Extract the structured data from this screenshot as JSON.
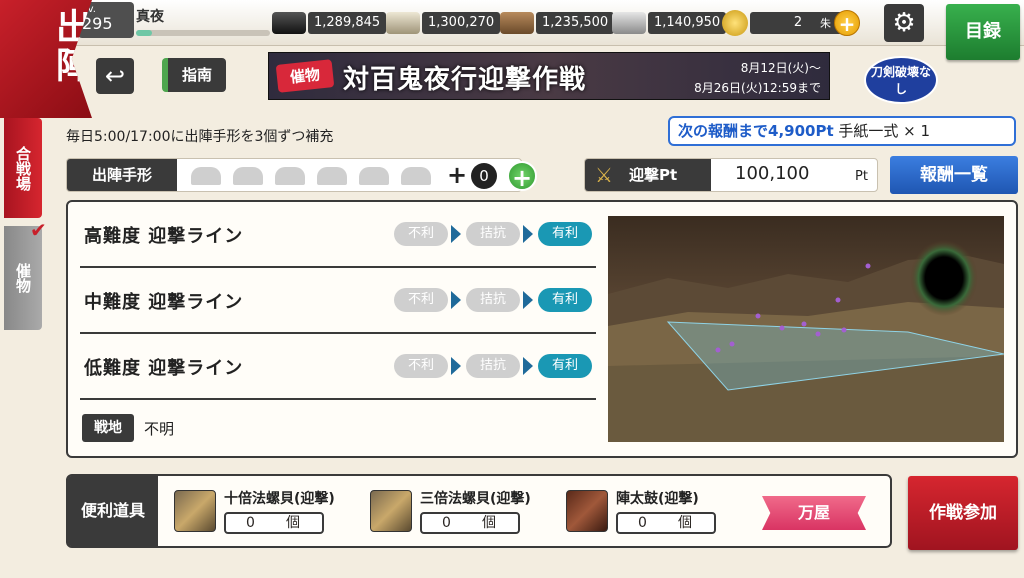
{
  "header": {
    "sortie_label": "出陣",
    "level_prefix": "Lv.",
    "level": "295",
    "player_name": "真夜",
    "xp_fraction": 0.12,
    "resources": [
      {
        "icon": "charcoal-icon",
        "value": "1,289,845"
      },
      {
        "icon": "jade-steel-icon",
        "value": "1,300,270"
      },
      {
        "icon": "cold-steel-icon",
        "value": "1,235,500"
      },
      {
        "icon": "whetstone-icon",
        "value": "1,140,950"
      }
    ],
    "coin_value": "2",
    "coin_unit": "朱",
    "catalog_label": "目録"
  },
  "nav": {
    "guide_label": "指南"
  },
  "banner": {
    "tag": "催物",
    "title": "対百鬼夜行迎撃作戦",
    "date_start": "8月12日(火)～",
    "date_end": "8月26日(火)12:59まで"
  },
  "sword_break": "刀剣破壊なし",
  "side_tabs": {
    "battle": "合戦場",
    "event": "催物"
  },
  "daily_note": "毎日5:00/17:00に出陣手形を3個ずつ補充",
  "next_reward": {
    "prefix": "次の報酬まで4,900Pt",
    "reward": "手紙一式 × 1"
  },
  "tegata": {
    "label": "出陣手形",
    "count": "0"
  },
  "points": {
    "label": "迎撃Pt",
    "value": "100,100",
    "unit": "Pt",
    "reward_list_label": "報酬一覧"
  },
  "lines": [
    {
      "name": "高難度 迎撃ライン",
      "states": [
        "不利",
        "拮抗",
        "有利"
      ]
    },
    {
      "name": "中難度 迎撃ライン",
      "states": [
        "不利",
        "拮抗",
        "有利"
      ]
    },
    {
      "name": "低難度 迎撃ライン",
      "states": [
        "不利",
        "拮抗",
        "有利"
      ]
    }
  ],
  "field": {
    "label": "戦地",
    "value": "不明"
  },
  "items": {
    "label": "便利道具",
    "list": [
      {
        "name": "十倍法螺貝(迎撃)",
        "count": "0",
        "unit": "個"
      },
      {
        "name": "三倍法螺貝(迎撃)",
        "count": "0",
        "unit": "個"
      },
      {
        "name": "陣太鼓(迎撃)",
        "count": "0",
        "unit": "個"
      }
    ],
    "shop_label": "万屋"
  },
  "join_label": "作戦参加",
  "colors": {
    "accent_red": "#c8202a",
    "favorable": "#1a98b4",
    "reward_blue": "#1f56b2",
    "catalog_green": "#1d7d2f"
  }
}
